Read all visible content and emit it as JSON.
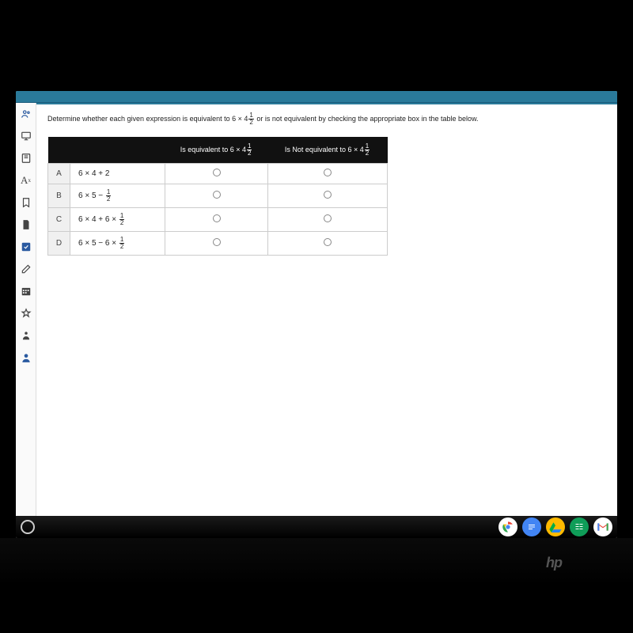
{
  "prompt": {
    "prefix": "Determine whether each given expression is equivalent to 6 × 4",
    "frac_num": "1",
    "frac_den": "2",
    "suffix": " or is not equivalent by checking the appropriate box in the table below."
  },
  "table": {
    "header_equiv_prefix": "Is equivalent to  6 × 4",
    "header_notequiv_prefix": "Is Not equivalent to  6 × 4",
    "header_frac_num": "1",
    "header_frac_den": "2",
    "rows": [
      {
        "label": "A",
        "expr_plain": "6 × 4 + 2",
        "has_frac": false
      },
      {
        "label": "B",
        "expr_prefix": "6 × 5 − ",
        "has_frac": true,
        "frac_num": "1",
        "frac_den": "2"
      },
      {
        "label": "C",
        "expr_prefix": "6 × 4 + 6 × ",
        "has_frac": true,
        "frac_num": "1",
        "frac_den": "2"
      },
      {
        "label": "D",
        "expr_prefix": "6 × 5 − 6 × ",
        "has_frac": true,
        "frac_num": "1",
        "frac_den": "2"
      }
    ]
  },
  "toolbar_icons": {
    "people": "people-icon",
    "present": "present-icon",
    "book": "book-icon",
    "text": "text-icon",
    "bookmark": "bookmark-icon",
    "page": "page-icon",
    "check": "check-icon",
    "edit": "edit-icon",
    "calendar": "calendar-icon",
    "star": "star-icon",
    "person": "person-icon",
    "user": "user-icon"
  },
  "taskbar": {
    "launcher": "○",
    "chrome": "",
    "docs": "",
    "drive": "",
    "sheets": "",
    "gmail": "M"
  },
  "device": {
    "brand": "hp"
  }
}
